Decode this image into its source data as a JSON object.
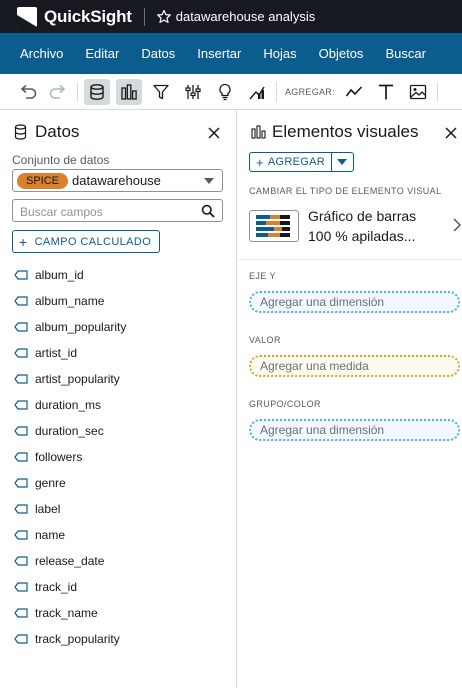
{
  "app": {
    "name": "QuickSight",
    "analysis_title": "datawarehouse analysis"
  },
  "menu": [
    "Archivo",
    "Editar",
    "Datos",
    "Insertar",
    "Hojas",
    "Objetos",
    "Buscar"
  ],
  "toolbar": {
    "add_label": "AGREGAR:",
    "icons": [
      "undo-icon",
      "redo-icon",
      "dataset-icon",
      "visuals-icon",
      "filter-icon",
      "parameters-icon",
      "insights-icon",
      "themes-icon",
      "line-chart-icon",
      "text-icon",
      "image-icon"
    ]
  },
  "data_panel": {
    "title": "Datos",
    "dataset_label": "Conjunto de datos",
    "spice_badge": "SPICE",
    "dataset_name": "datawarehouse",
    "search_placeholder": "Buscar campos",
    "calc_field_label": "CAMPO CALCULADO",
    "fields": [
      "album_id",
      "album_name",
      "album_popularity",
      "artist_id",
      "artist_popularity",
      "duration_ms",
      "duration_sec",
      "followers",
      "genre",
      "label",
      "name",
      "release_date",
      "track_id",
      "track_name",
      "track_popularity"
    ]
  },
  "visuals_panel": {
    "title": "Elementos visuales",
    "add_label": "AGREGAR",
    "change_type_label": "CAMBIAR EL TIPO DE ELEMENTO VISUAL",
    "visual_name_line1": "Gráfico de barras",
    "visual_name_line2": "100 % apiladas...",
    "x_axis_label": "EJE Y",
    "x_axis_placeholder": "Agregar una dimensión",
    "value_label": "VALOR",
    "value_placeholder": "Agregar una medida",
    "group_label": "GRUPO/COLOR",
    "group_placeholder": "Agregar una dimensión"
  },
  "colors": {
    "titlebar": "#16191f",
    "menubar": "#0b5d8e",
    "spice": "#d9812c",
    "dimension_well": "#44b9d6",
    "measure_well": "#d9a02c"
  }
}
